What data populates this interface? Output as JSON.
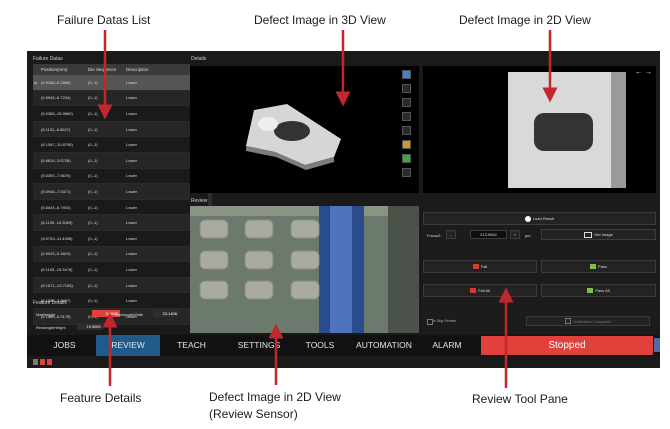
{
  "callouts": {
    "failure_list": "Failure Datas List",
    "defect_3d": "Defect Image in 3D View",
    "defect_2d": "Defect Image in 2D View",
    "feature_details": "Feature Details",
    "defect_2d_review_line1": "Defect Image in 2D View",
    "defect_2d_review_line2": "(Review Sensor)",
    "review_tool": "Review Tool Pane"
  },
  "failure_datas": {
    "title": "Failure Datas",
    "columns": [
      "Position(mm)",
      "Die Sequence",
      "Description"
    ],
    "rows": [
      {
        "pos": "(6.9188,-6.2886)",
        "seq": "(0,-1)",
        "desc": "Lower"
      },
      {
        "pos": "(5.5948,-6.7234)",
        "seq": "(0,-1)",
        "desc": "Lower"
      },
      {
        "pos": "(5.0385,-15.9660)",
        "seq": "(0,-1)",
        "desc": "Lower"
      },
      {
        "pos": "(6.1131,-6.8627)",
        "seq": "(0,-1)",
        "desc": "Lower"
      },
      {
        "pos": "(6.1067,-10.8706)",
        "seq": "(0,-1)",
        "desc": "Lower"
      },
      {
        "pos": "(5.6816,-3.6728)",
        "seq": "(0,-1)",
        "desc": "Lower"
      },
      {
        "pos": "(5.0392,-7.6676)",
        "seq": "(0,-1)",
        "desc": "Lower"
      },
      {
        "pos": "(5.0946,-7.5371)",
        "seq": "(0,-1)",
        "desc": "Lower"
      },
      {
        "pos": "(5.6444,-6.7903)",
        "seq": "(0,-1)",
        "desc": "Lower"
      },
      {
        "pos": "(6.1139,-10.3069)",
        "seq": "(0,-1)",
        "desc": "Lower"
      },
      {
        "pos": "(6.0753,-11.4398)",
        "seq": "(0,-1)",
        "desc": "Lower"
      },
      {
        "pos": "(5.5043,-5.4819)",
        "seq": "(0,-1)",
        "desc": "Lower"
      },
      {
        "pos": "(6.1105,-15.3478)",
        "seq": "(0,-1)",
        "desc": "Lower"
      },
      {
        "pos": "(6.1571,-13.7158)",
        "seq": "(0,-1)",
        "desc": "Lower"
      },
      {
        "pos": "(6.1585,-3.8497)",
        "seq": "(0,-1)",
        "desc": "Lower"
      },
      {
        "pos": "(6.1585,-6.5178)",
        "seq": "(0,-1)",
        "desc": "Lower"
      }
    ]
  },
  "feature_details": {
    "title": "Feature Details",
    "max_height_label": "MaxHeight",
    "max_height_value": "5.0692",
    "rect_width_label": "RectangleWidth",
    "rect_width_value": "33.1406",
    "rect_height_label": "RectangleHeight",
    "rect_height_value": "19.5591"
  },
  "details": {
    "title": "Details"
  },
  "review": {
    "title": "Review"
  },
  "review_tool": {
    "load_result": "Load Result",
    "focus_label": "FocusZ:",
    "minus": "-",
    "focus_value": "213.5962",
    "plus": "+",
    "unit": "μm",
    "get_image": "Get Image",
    "fail": "Fail",
    "pass": "Pass",
    "fail_all": "Fail All",
    "pass_all": "Pass All",
    "skip_review": "Is Skip Review",
    "verification_complete": "Verification Complete"
  },
  "nav": {
    "tabs": [
      "JOBS",
      "REVIEW",
      "TEACH",
      "SETTINGS",
      "TOOLS",
      "AUTOMATION",
      "ALARM"
    ],
    "active": "REVIEW",
    "status": "Stopped"
  },
  "colors": {
    "status_bg": "#e0413b",
    "active_tab": "#1f5a8a",
    "annotation_arrow": "#c1272d"
  }
}
